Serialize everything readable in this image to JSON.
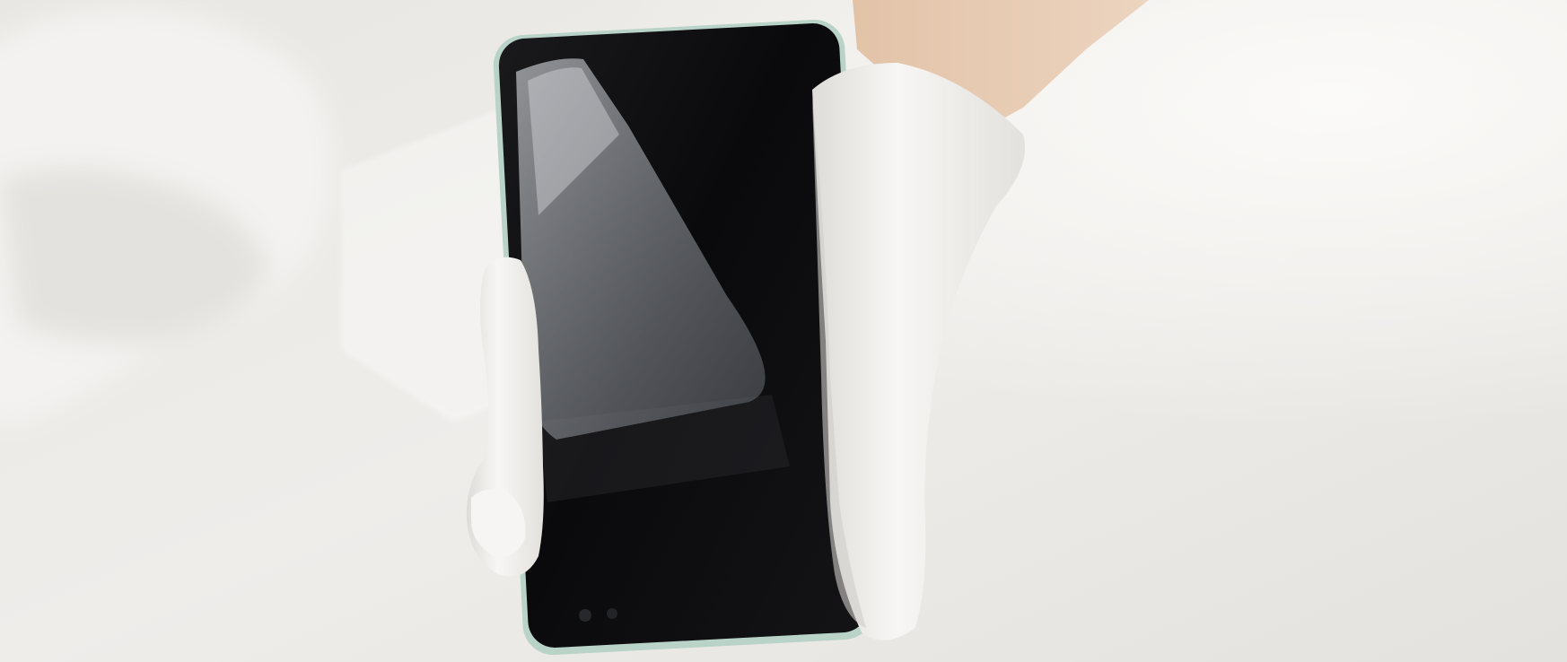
{
  "photo": {
    "subject": "gloved-hands-applying-phone-screen-protector",
    "colors": {
      "background": "#eceae6",
      "background_shadow": "#dcdad6",
      "glove": "#f4f3f1",
      "glove_shade": "#d9d7d3",
      "phone_screen": "#0b0b0d",
      "phone_frame": "#b9d3c9",
      "film": "#9fa3a8",
      "skin": "#e6c9b0"
    }
  }
}
